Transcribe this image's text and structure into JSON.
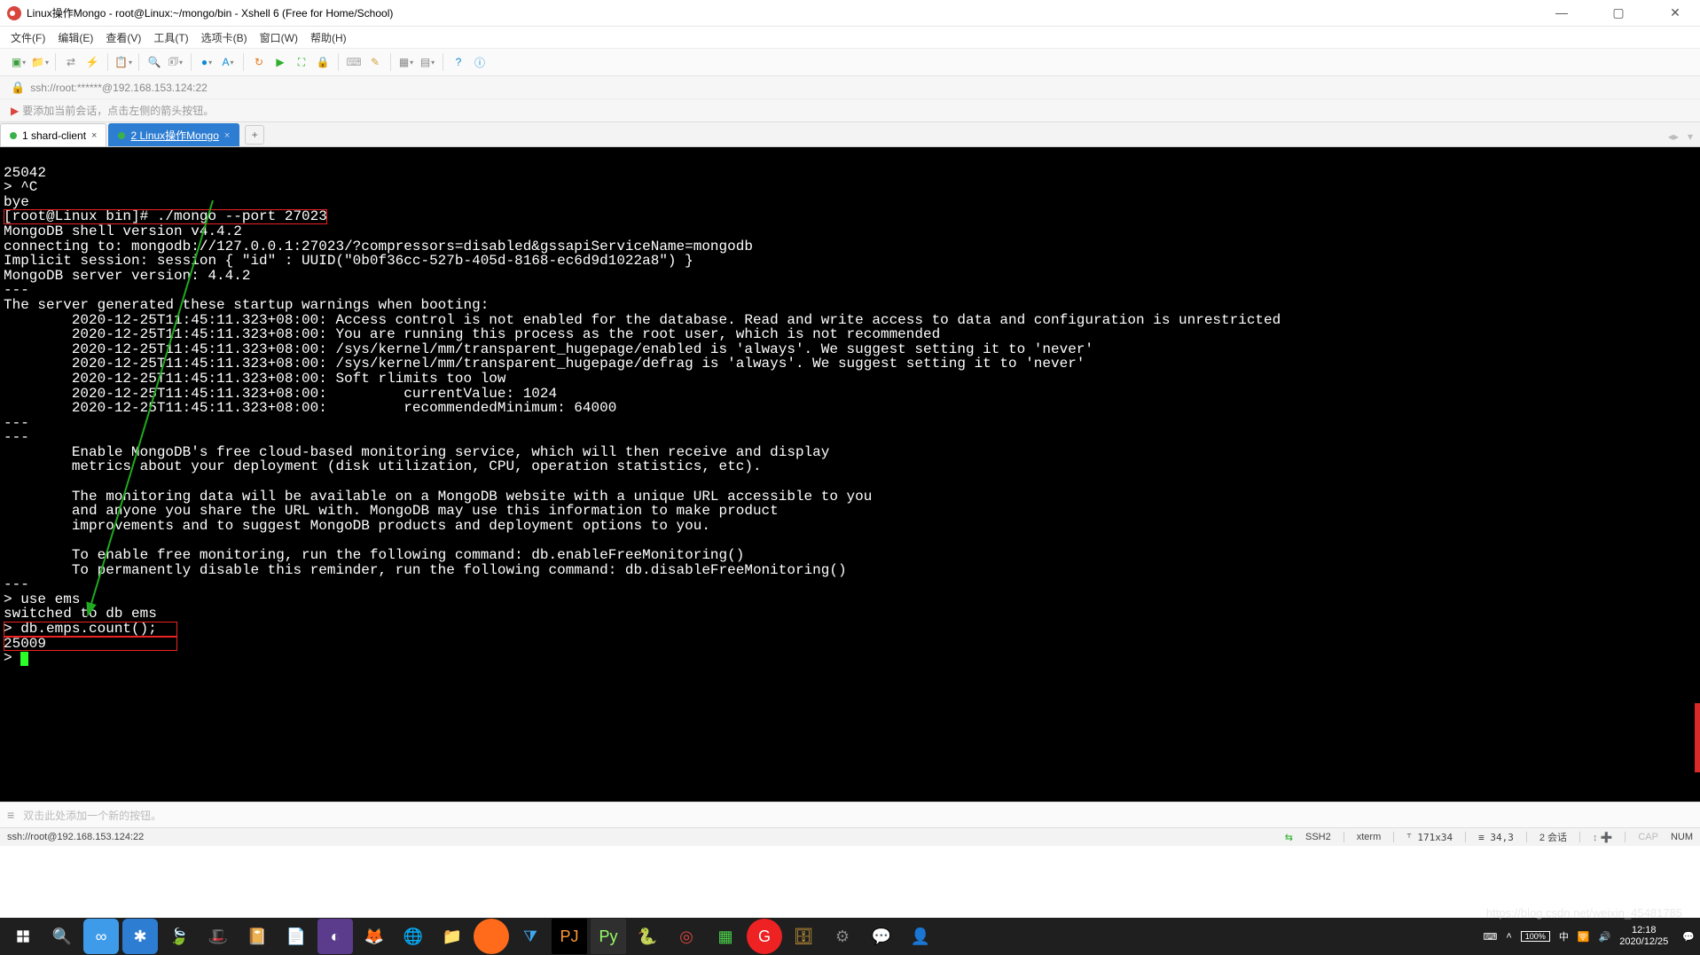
{
  "window": {
    "title": "Linux操作Mongo - root@Linux:~/mongo/bin - Xshell 6 (Free for Home/School)"
  },
  "menu": {
    "file": "文件(F)",
    "edit": "编辑(E)",
    "view": "查看(V)",
    "tools": "工具(T)",
    "tabs": "选项卡(B)",
    "window": "窗口(W)",
    "help": "帮助(H)"
  },
  "address": "ssh://root:******@192.168.153.124:22",
  "hint": "要添加当前会话，点击左侧的箭头按钮。",
  "tabs": {
    "t1": "1 shard-client",
    "t2": "2 Linux操作Mongo"
  },
  "terminal": {
    "l0": "25042",
    "l1": "> ^C",
    "l2": "bye",
    "l3": "[root@Linux bin]# ./mongo --port 27023",
    "l4": "MongoDB shell version v4.4.2",
    "l5": "connecting to: mongodb://127.0.0.1:27023/?compressors=disabled&gssapiServiceName=mongodb",
    "l6": "Implicit session: session { \"id\" : UUID(\"0b0f36cc-527b-405d-8168-ec6d9d1022a8\") }",
    "l7": "MongoDB server version: 4.4.2",
    "l8": "---",
    "l9": "The server generated these startup warnings when booting:",
    "l10": "        2020-12-25T11:45:11.323+08:00: Access control is not enabled for the database. Read and write access to data and configuration is unrestricted",
    "l11": "        2020-12-25T11:45:11.323+08:00: You are running this process as the root user, which is not recommended",
    "l12": "        2020-12-25T11:45:11.323+08:00: /sys/kernel/mm/transparent_hugepage/enabled is 'always'. We suggest setting it to 'never'",
    "l13": "        2020-12-25T11:45:11.323+08:00: /sys/kernel/mm/transparent_hugepage/defrag is 'always'. We suggest setting it to 'never'",
    "l14": "        2020-12-25T11:45:11.323+08:00: Soft rlimits too low",
    "l15": "        2020-12-25T11:45:11.323+08:00:         currentValue: 1024",
    "l16": "        2020-12-25T11:45:11.323+08:00:         recommendedMinimum: 64000",
    "l17": "---",
    "l18": "---",
    "l19": "        Enable MongoDB's free cloud-based monitoring service, which will then receive and display",
    "l20": "        metrics about your deployment (disk utilization, CPU, operation statistics, etc).",
    "l21": "",
    "l22": "        The monitoring data will be available on a MongoDB website with a unique URL accessible to you",
    "l23": "        and anyone you share the URL with. MongoDB may use this information to make product",
    "l24": "        improvements and to suggest MongoDB products and deployment options to you.",
    "l25": "",
    "l26": "        To enable free monitoring, run the following command: db.enableFreeMonitoring()",
    "l27": "        To permanently disable this reminder, run the following command: db.disableFreeMonitoring()",
    "l28": "---",
    "l29": "> use ems",
    "l30": "switched to db ems",
    "l31": "> db.emps.count();",
    "l32": "25009",
    "l33": "> "
  },
  "buttonbar_hint": "双击此处添加一个新的按钮。",
  "status": {
    "left": "ssh://root@192.168.153.124:22",
    "ssh": "SSH2",
    "term": "xterm",
    "size": "171x34",
    "pos": "34,3",
    "sessions": "2 会话",
    "cap": "CAP",
    "num": "NUM"
  },
  "tray": {
    "time": "12:18",
    "date": "2020/12/25"
  },
  "watermark": "https://blog.csdn.net/weixin_45481785"
}
